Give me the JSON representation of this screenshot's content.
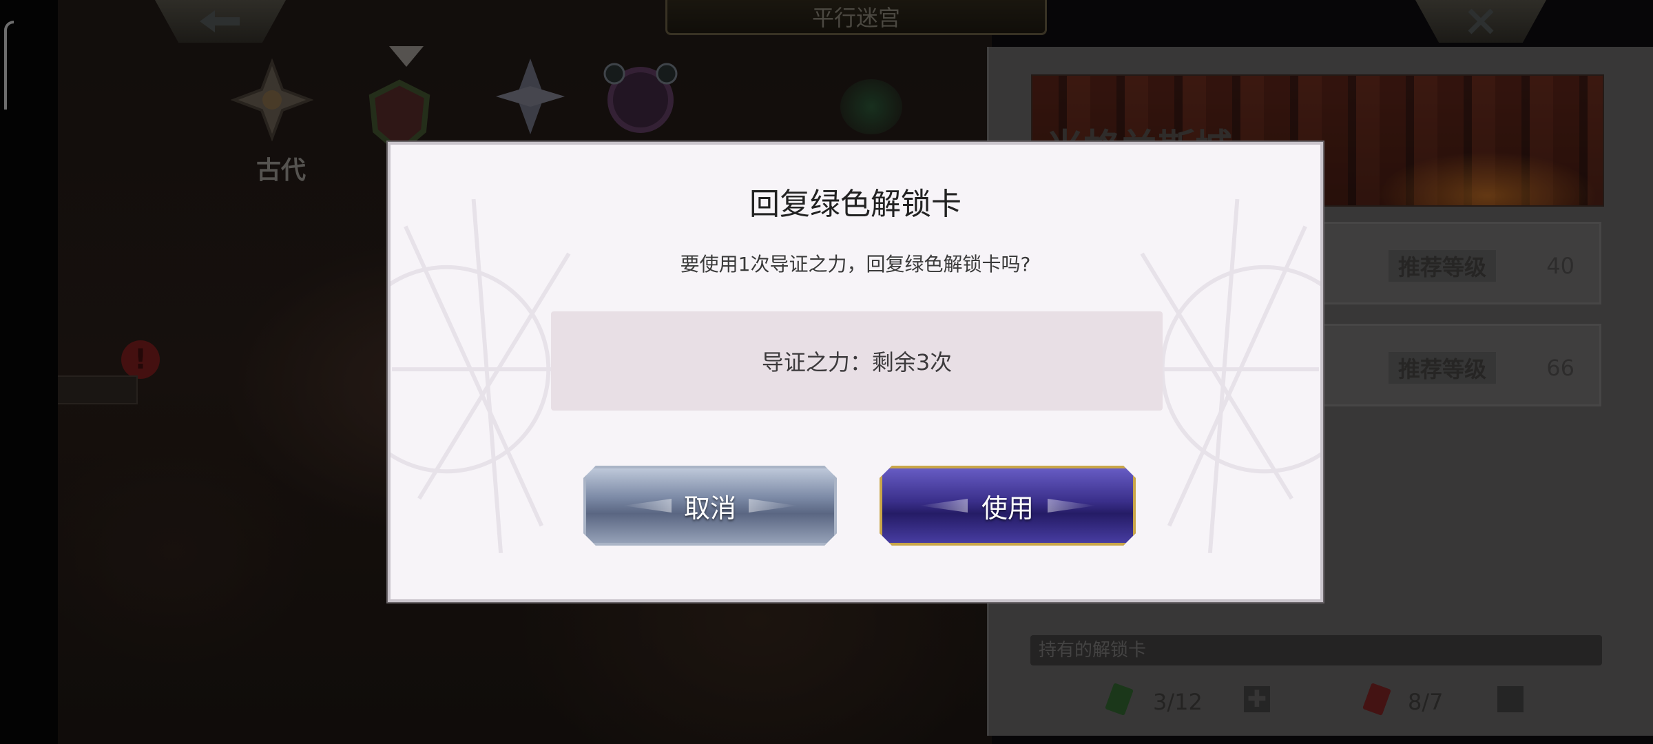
{
  "header": {
    "title": "平行迷宫"
  },
  "map": {
    "era_label": "古代",
    "alert_badge": "!"
  },
  "panel": {
    "banner_title": "米格兰斯城",
    "stages": [
      {
        "recommend_label": "推荐等级",
        "level": "40"
      },
      {
        "recommend_label": "推荐等级",
        "level": "66"
      }
    ],
    "cards_label": "持有的解锁卡",
    "green_card_count": "3/12",
    "red_card_count": "8/7"
  },
  "dialog": {
    "title": "回复绿色解锁卡",
    "message": "要使用1次导证之力，回复绿色解锁卡吗?",
    "info": "导证之力：剩余3次",
    "cancel_label": "取消",
    "use_label": "使用"
  },
  "icons": {
    "back": "arrow-left-icon",
    "close": "close-icon"
  },
  "colors": {
    "dialog_bg": "#f7f4f8",
    "info_box": "#e8dfe5",
    "cancel_button": "#7c8aa6",
    "use_button": "#3a2f8a",
    "use_button_border": "#c9a648"
  }
}
